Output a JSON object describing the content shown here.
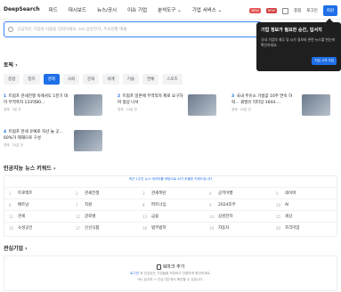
{
  "header": {
    "logo": "DeepSearch",
    "nav": [
      "피드",
      "대시보드",
      "뉴스/공시",
      "이슈 기업",
      "분석도구 ⌄",
      "기업 서비스 ⌄"
    ],
    "badges": [
      "NEW",
      "NEW"
    ],
    "login": "로그인",
    "pricing": "종합",
    "signup": "회원"
  },
  "search": {
    "placeholder": "궁금하신 기업의 이름을 입력하세요. ex) 삼성전자, 주요현황 매출"
  },
  "popup": {
    "title": "기업 정보가 필요한 순간, 딥서치",
    "desc": "국내 기업의 재무 및 시가 정보와 관련 뉴스를 한눈에 확인하세요.",
    "button": "지금 시작 가입"
  },
  "topics": {
    "title": "토픽 ›",
    "chips": [
      "종합",
      "정치",
      "경제",
      "사회",
      "문화",
      "세계",
      "기술",
      "연예",
      "스포츠"
    ],
    "active_index": 2
  },
  "news": [
    {
      "num": "1",
      "title": "트럼프 관세전쟁 속에서도 1분기 대미 무역흑자 133억80…",
      "meta": "경제 · 3분 전"
    },
    {
      "num": "2",
      "title": "트럼프 일본에 무역적자 제로 요구하며 협상 나서",
      "meta": "경제 · 24분 전"
    },
    {
      "num": "3",
      "title": "국내 주유소 기름값 10주 연속 하락… 휘발유 리터당 1644.…",
      "meta": "경제 · 24분 전"
    },
    {
      "num": "4",
      "title": "트럼프 관세 유예로 자산 늘 곳… 60%가 제재으로 구성",
      "meta": "경제 · 24분 전"
    }
  ],
  "keywords": {
    "title": "인공지능 뉴스 키워드 ›",
    "note": "최근 1주간 뉴스 데이터를 바탕으로 AI가 추출한 키워드입니다",
    "items": [
      "트로백트",
      "관세전쟁",
      "관세폭탄",
      "공키마켓",
      "네이버",
      "배트남",
      "지원",
      "퍼트너십",
      "2024조주",
      "AI",
      "관세",
      "글로벌",
      "금융",
      "삼성전자",
      "세상",
      "소성곳인",
      "신선식품",
      "법무법학",
      "자동차",
      "프리미엄"
    ]
  },
  "watchlist": {
    "title": "관심기업 ›",
    "box_title": "북마크 추가",
    "desc1_link": "로그인",
    "desc1": "후 관심있는 기업들을 저장하고 간편하게 확인하세요.",
    "desc2": "'My 딥서치 > 관심기업'에서 확인할 수 있습니다."
  }
}
